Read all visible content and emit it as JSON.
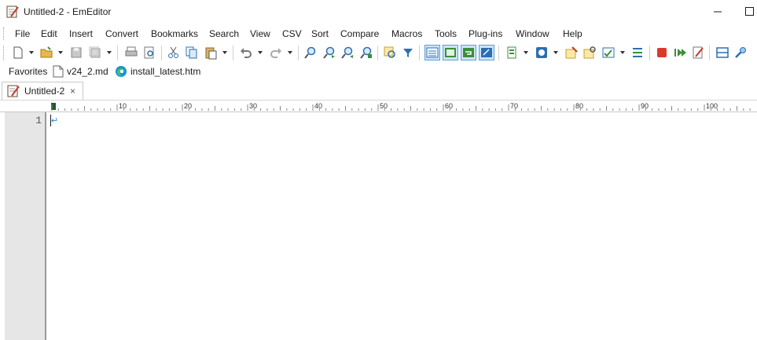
{
  "window": {
    "title": "Untitled-2 - EmEditor"
  },
  "menu": [
    "File",
    "Edit",
    "Insert",
    "Convert",
    "Bookmarks",
    "Search",
    "View",
    "CSV",
    "Sort",
    "Compare",
    "Macros",
    "Tools",
    "Plug-ins",
    "Window",
    "Help"
  ],
  "toolbar": {
    "buttons": [
      "new-document",
      "open",
      "save",
      "save-all",
      "print",
      "print-preview",
      "cut",
      "copy",
      "paste",
      "undo",
      "redo",
      "find",
      "find-next",
      "find-previous",
      "find-in-files",
      "filter",
      "select-toolbar",
      "view-tb-1",
      "view-tb-2",
      "view-tb-3",
      "view-tb-4",
      "view-tb-5",
      "view-tb-6",
      "view-tb-7",
      "view-tb-8",
      "view-tb-9",
      "macro-record",
      "macro-run",
      "macro-edit",
      "window-split",
      "plugin"
    ]
  },
  "favorites": {
    "label": "Favorites",
    "items": [
      {
        "name": "v24_2.md",
        "icon": "document-icon"
      },
      {
        "name": "install_latest.htm",
        "icon": "edge-browser-icon"
      }
    ]
  },
  "tabs": [
    {
      "label": "Untitled-2",
      "close": "×"
    }
  ],
  "ruler": {
    "labels": [
      "10",
      "20",
      "30",
      "40",
      "50",
      "60",
      "70",
      "80",
      "90",
      "100"
    ]
  },
  "editor": {
    "line_numbers": [
      "1"
    ],
    "lines": [
      ""
    ],
    "eol_mark": "↵"
  },
  "colors": {
    "accent": "#2a8ad0",
    "gutter": "#e6e6e6",
    "ruler_marker": "#1f5c2a"
  }
}
